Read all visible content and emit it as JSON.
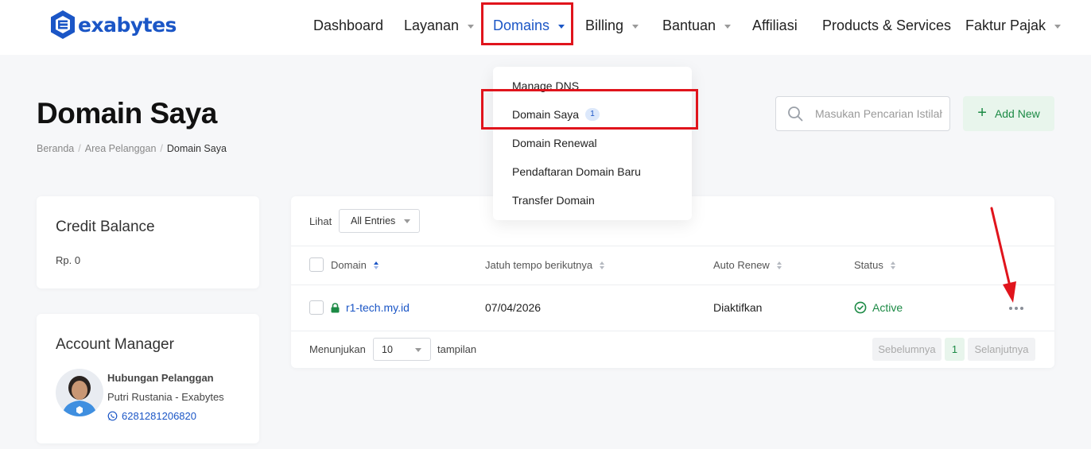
{
  "brand": {
    "name": "exabytes",
    "color": "#1b56c6"
  },
  "nav": {
    "items": [
      {
        "label": "Dashboard",
        "has_caret": false
      },
      {
        "label": "Layanan",
        "has_caret": true
      },
      {
        "label": "Domains",
        "has_caret": true,
        "active": true
      },
      {
        "label": "Billing",
        "has_caret": true
      },
      {
        "label": "Bantuan",
        "has_caret": true
      },
      {
        "label": "Affiliasi",
        "has_caret": false
      },
      {
        "label": "Products & Services",
        "has_caret": false
      },
      {
        "label": "Faktur Pajak",
        "has_caret": true
      }
    ]
  },
  "domains_menu": {
    "items": [
      {
        "label": "Manage DNS"
      },
      {
        "label": "Domain Saya",
        "badge": "1"
      },
      {
        "label": "Domain Renewal"
      },
      {
        "label": "Pendaftaran Domain Baru"
      },
      {
        "label": "Transfer Domain"
      }
    ]
  },
  "page": {
    "title": "Domain Saya",
    "breadcrumb": [
      "Beranda",
      "Area Pelanggan",
      "Domain Saya"
    ]
  },
  "search": {
    "placeholder": "Masukan Pencarian Istilah"
  },
  "add_new": {
    "label": "Add New"
  },
  "credit": {
    "title": "Credit Balance",
    "value": "Rp. 0"
  },
  "account_manager": {
    "title": "Account Manager",
    "name": "Hubungan Pelanggan",
    "subtitle": "Putri Rustania - Exabytes",
    "phone": "6281281206820"
  },
  "table": {
    "show_label": "Lihat",
    "entries_select": "All Entries",
    "columns": [
      "Domain",
      "Jatuh tempo berikutnya",
      "Auto Renew",
      "Status"
    ],
    "rows": [
      {
        "domain": "r1-tech.my.id",
        "due": "07/04/2026",
        "auto_renew": "Diaktifkan",
        "status": "Active"
      }
    ],
    "footer": {
      "show_prefix": "Menunjukan",
      "page_size": "10",
      "show_suffix": "tampilan",
      "prev": "Sebelumnya",
      "page": "1",
      "next": "Selanjutnya"
    }
  },
  "colors": {
    "accent": "#1b56c6",
    "success": "#1c8a45",
    "highlight": "#e0141c"
  }
}
